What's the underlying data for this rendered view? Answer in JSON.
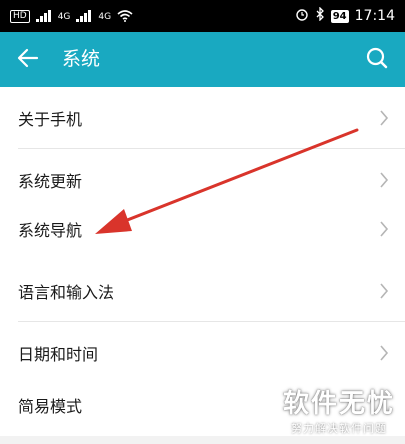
{
  "status_bar": {
    "hd_badge": "HD",
    "sig1_label": "4G",
    "sig2_label": "4G",
    "battery": "94",
    "time": "17:14"
  },
  "app_bar": {
    "title": "系统",
    "color": "#19a9c1"
  },
  "groups": [
    {
      "items": [
        {
          "label": "关于手机"
        },
        {
          "label": "系统更新"
        }
      ]
    },
    {
      "items": [
        {
          "label": "系统导航"
        }
      ]
    },
    {
      "items": [
        {
          "label": "语言和输入法"
        },
        {
          "label": "日期和时间"
        }
      ]
    },
    {
      "items": [
        {
          "label": "简易模式"
        }
      ]
    }
  ],
  "annotation": {
    "arrow_color": "#d9342b",
    "points_to": "系统导航"
  },
  "watermark": {
    "main": "软件无忧",
    "sub": "努力解决软件问题"
  }
}
